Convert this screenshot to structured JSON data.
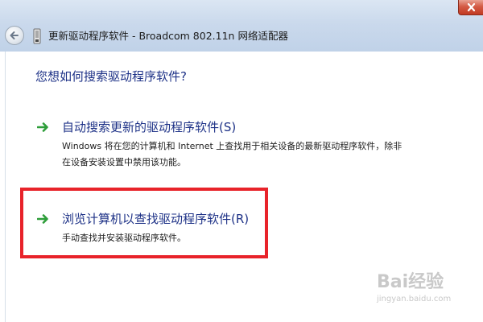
{
  "window": {
    "title": "更新驱动程序软件 - Broadcom 802.11n 网络适配器"
  },
  "icons": {
    "back": "back-arrow-icon",
    "device": "network-adapter-icon",
    "option_arrow": "green-arrow-icon",
    "close": "close-icon"
  },
  "colors": {
    "heading": "#1e3287",
    "arrow": "#2e9e3a",
    "highlight_border": "#e8232a",
    "close_button": "#c23a22"
  },
  "main": {
    "question": "您想如何搜索驱动程序软件?",
    "options": [
      {
        "title": "自动搜索更新的驱动程序软件(S)",
        "description": "Windows 将在您的计算机和 Internet 上查找用于相关设备的最新驱动程序软件，除非在设备安装设置中禁用该功能。"
      },
      {
        "title": "浏览计算机以查找驱动程序软件(R)",
        "description": "手动查找并安装驱动程序软件。"
      }
    ]
  },
  "watermark": {
    "text": "Bai经验",
    "subtext": "jingyan.baidu.com"
  }
}
